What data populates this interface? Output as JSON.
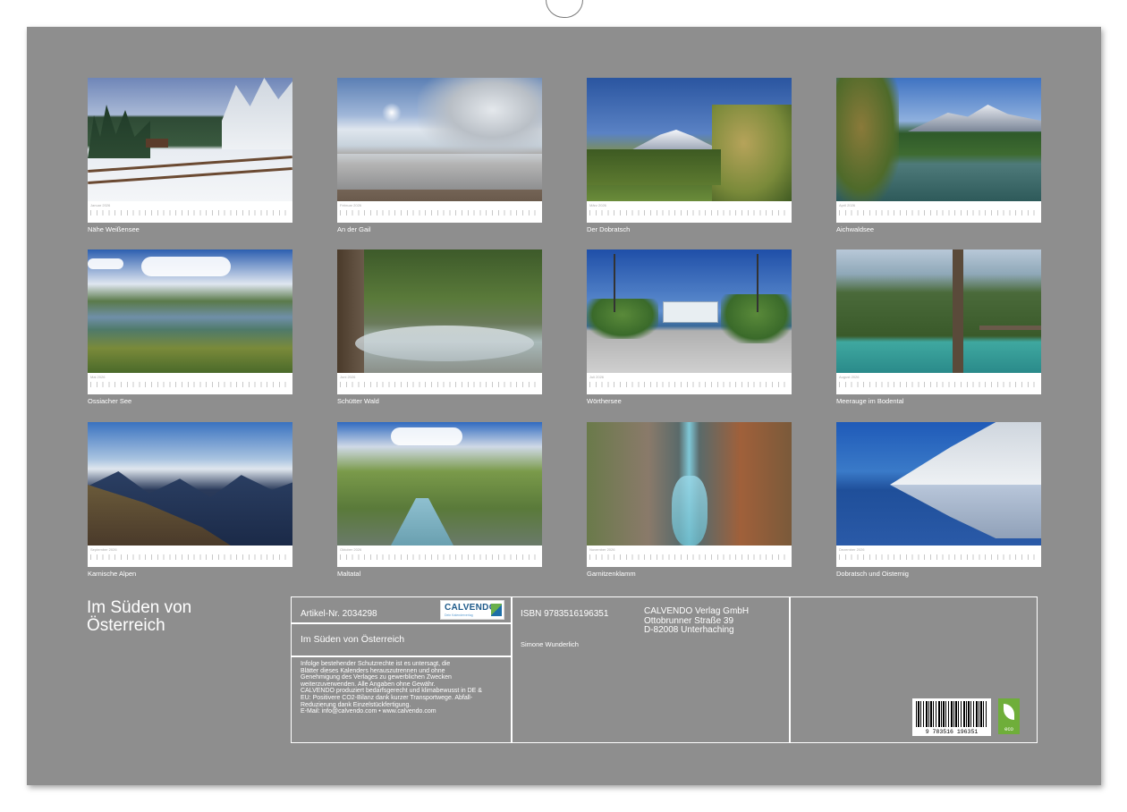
{
  "calendar": {
    "title_line1": "Im Süden von",
    "title_line2": "Österreich",
    "months": [
      {
        "caption": "Nähe Weißensee",
        "month": "Januar 2026"
      },
      {
        "caption": "An der Gail",
        "month": "Februar 2026"
      },
      {
        "caption": "Der Dobratsch",
        "month": "März 2026"
      },
      {
        "caption": "Aichwaldsee",
        "month": "April 2026"
      },
      {
        "caption": "Ossiacher See",
        "month": "Mai 2026"
      },
      {
        "caption": "Schütter Wald",
        "month": "Juni 2026"
      },
      {
        "caption": "Wörthersee",
        "month": "Juli 2026"
      },
      {
        "caption": "Meerauge im Bodental",
        "month": "August 2026"
      },
      {
        "caption": "Karnische Alpen",
        "month": "September 2026"
      },
      {
        "caption": "Maltatal",
        "month": "Oktober 2026"
      },
      {
        "caption": "Garnitzenklamm",
        "month": "November 2026"
      },
      {
        "caption": "Dobratsch und Oisternig",
        "month": "Dezember 2026"
      }
    ]
  },
  "info": {
    "article_no": "Artikel-Nr. 2034298",
    "logo_name": "CALVENDO",
    "logo_tagline": "Dein Kalenderverlag",
    "product_title": "Im Süden von Österreich",
    "legal_lines": [
      "Infolge bestehender Schutzrechte ist es untersagt, die",
      "Blätter dieses Kalenders herauszutrennen und ohne",
      "Genehmigung des Verlages zu gewerblichen Zwecken",
      "weiterzuverwenden. Alle Angaben ohne Gewähr.",
      "CALVENDO produziert bedarfsgerecht und klimabewusst in DE &",
      "EU: Positivere CO2-Bilanz dank kurzer Transportwege. Abfall-",
      "Reduzierung dank Einzelstückfertigung.",
      "E-Mail: info@calvendo.com • www.calvendo.com"
    ],
    "isbn": "ISBN 9783516196351",
    "author": "Simone Wunderlich",
    "publisher_line1": "CALVENDO Verlag GmbH",
    "publisher_line2": "Ottobrunner Straße 39",
    "publisher_line3": "D-82008 Unterhaching",
    "barcode_number": "9 783516 196351",
    "eco_label": "eco"
  },
  "colors": {
    "page_gray": "#8e8e8e",
    "text_white": "#ffffff",
    "eco_green": "#6fae3a"
  }
}
